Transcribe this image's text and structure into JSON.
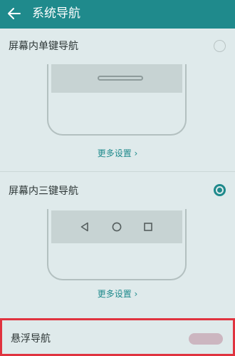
{
  "header": {
    "title": "系统导航"
  },
  "options": [
    {
      "label": "屏幕内单键导航",
      "more": "更多设置 ›",
      "selected": false
    },
    {
      "label": "屏幕内三键导航",
      "more": "更多设置 ›",
      "selected": true
    }
  ],
  "floating": {
    "label": "悬浮导航",
    "toggle_on": false
  },
  "colors": {
    "accent": "#1f8a8c",
    "highlight": "#e0333f",
    "background": "#dfeaeb"
  },
  "icons": {
    "back": "arrow-left-icon",
    "nav_back": "triangle-left-icon",
    "nav_home": "circle-icon",
    "nav_recent": "square-icon"
  }
}
